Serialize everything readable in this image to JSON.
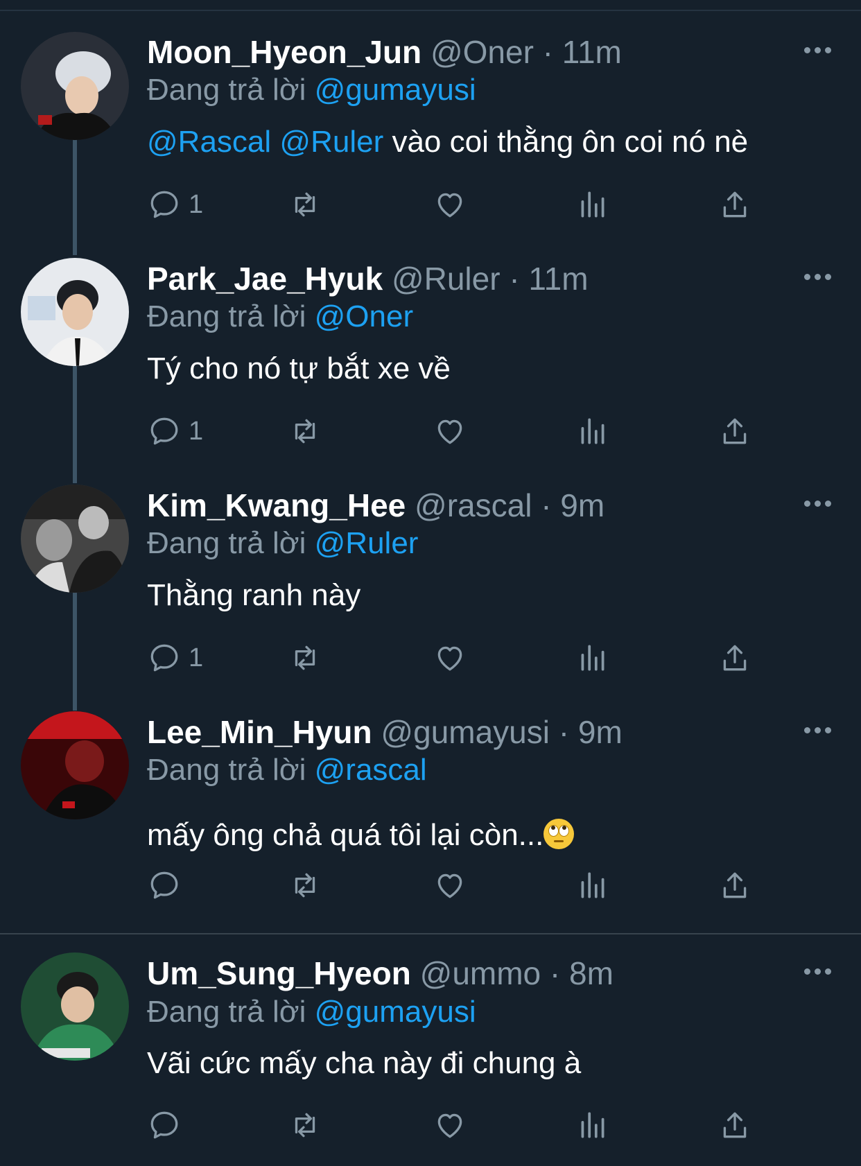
{
  "tweets": [
    {
      "name": "Moon_Hyeon_Jun",
      "handle": "@Oner · 11m",
      "reply_prefix": "Đang trả lời",
      "reply_to": "@gumayusi",
      "mention1": "@Rascal",
      "mention2": "@Ruler",
      "text": " vào coi thằng ôn coi nó nè",
      "reply_count": "1",
      "avatar_palette": [
        "#2a2f38",
        "#d9dde3",
        "#b31b1b"
      ]
    },
    {
      "name": "Park_Jae_Hyuk",
      "handle": "@Ruler · 11m",
      "reply_prefix": "Đang trả lời",
      "reply_to": "@Oner",
      "text": "Tý cho nó tự bắt xe về",
      "reply_count": "1",
      "avatar_palette": [
        "#e7eaee",
        "#1c1f24",
        "#f2f2f2"
      ]
    },
    {
      "name": "Kim_Kwang_Hee",
      "handle": "@rascal · 9m",
      "reply_prefix": "Đang trả lời",
      "reply_to": "@Ruler",
      "text": "Thằng ranh này",
      "reply_count": "1",
      "avatar_palette": [
        "#444444",
        "#bbbbbb",
        "#1a1a1a"
      ]
    },
    {
      "name": "Lee_Min_Hyun",
      "handle": "@gumayusi · 9m",
      "reply_prefix": "Đang trả lời",
      "reply_to": "@rascal",
      "text": "mấy ông chả quá tôi lại còn...",
      "reply_count": "",
      "avatar_palette": [
        "#3a0608",
        "#c4161c",
        "#0d0d0d"
      ]
    },
    {
      "name": "Um_Sung_Hyeon",
      "handle": "@ummo · 8m",
      "reply_prefix": "Đang trả lời",
      "reply_to": "@gumayusi",
      "text": "Vãi cức mấy cha này đi chung à",
      "reply_count": "",
      "avatar_palette": [
        "#1f4d34",
        "#2e8b57",
        "#e6e6e6"
      ]
    }
  ],
  "icons": [
    "reply-icon",
    "retweet-icon",
    "like-icon",
    "views-icon",
    "share-icon",
    "more-icon",
    "face-with-rolling-eyes-emoji"
  ],
  "colors": {
    "background": "#15202b",
    "secondary_text": "#8899a6",
    "link": "#1da1f2",
    "thread_line": "#3d5466"
  }
}
